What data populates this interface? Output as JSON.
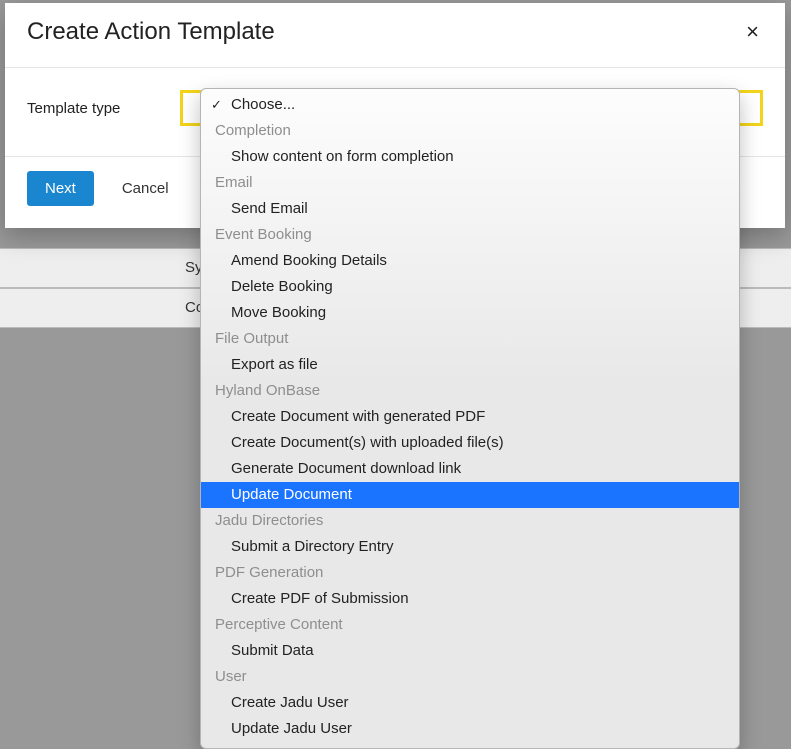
{
  "modal": {
    "title": "Create Action Template",
    "field_label": "Template type",
    "next_label": "Next",
    "cancel_label": "Cancel"
  },
  "bg": {
    "row1": "Sy",
    "row2": "Co"
  },
  "dropdown": {
    "choose": "Choose...",
    "groups": [
      {
        "label": "Completion",
        "items": [
          "Show content on form completion"
        ]
      },
      {
        "label": "Email",
        "items": [
          "Send Email"
        ]
      },
      {
        "label": "Event Booking",
        "items": [
          "Amend Booking Details",
          "Delete Booking",
          "Move Booking"
        ]
      },
      {
        "label": "File Output",
        "items": [
          "Export as file"
        ]
      },
      {
        "label": "Hyland OnBase",
        "items": [
          "Create Document with generated PDF",
          "Create Document(s) with uploaded file(s)",
          "Generate Document download link",
          "Update Document"
        ]
      },
      {
        "label": "Jadu Directories",
        "items": [
          "Submit a Directory Entry"
        ]
      },
      {
        "label": "PDF Generation",
        "items": [
          "Create PDF of Submission"
        ]
      },
      {
        "label": "Perceptive Content",
        "items": [
          "Submit Data"
        ]
      },
      {
        "label": "User",
        "items": [
          "Create Jadu User",
          "Update Jadu User"
        ]
      }
    ],
    "highlighted": "Update Document"
  }
}
